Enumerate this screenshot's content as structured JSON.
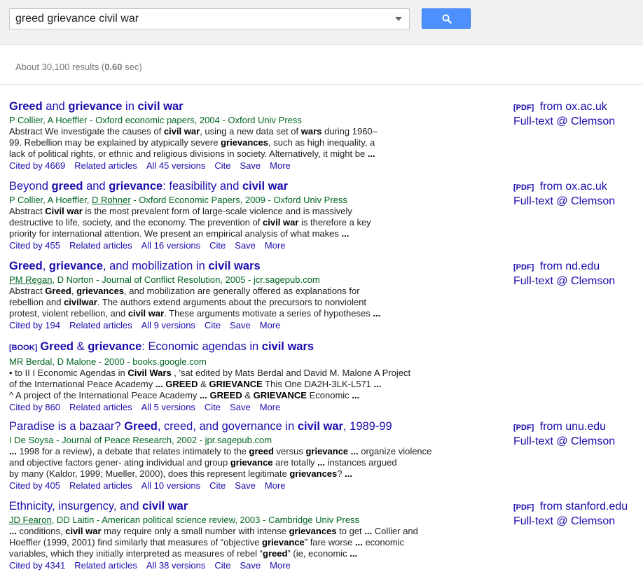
{
  "search": {
    "query": "greed grievance civil war"
  },
  "stats": {
    "prefix": "About 30,100 results (",
    "time": "0.60",
    "suffix": " sec)"
  },
  "results": [
    {
      "book_tag": "",
      "title": [
        [
          "Greed",
          true
        ],
        [
          " and ",
          false
        ],
        [
          "grievance",
          true
        ],
        [
          " in ",
          false
        ],
        [
          "civil war",
          true
        ]
      ],
      "authors": [
        [
          "P Collier, A Hoeffler - Oxford economic papers, 2004 - Oxford Univ Press",
          false
        ]
      ],
      "snippet": [
        [
          [
            "Abstract We investigate the causes of ",
            false
          ],
          [
            "civil war",
            true
          ],
          [
            ", using a new data set of ",
            false
          ],
          [
            "wars",
            true
          ],
          [
            " during 1960–",
            false
          ]
        ],
        [
          [
            "99. Rebellion may be explained by atypically severe ",
            false
          ],
          [
            "grievances",
            true
          ],
          [
            ", such as high inequality, a",
            false
          ]
        ],
        [
          [
            "lack of political rights, or ethnic and religious divisions in society. Alternatively, it might be ",
            false
          ],
          [
            "...",
            true
          ]
        ]
      ],
      "links": [
        "Cited by 4669",
        "Related articles",
        "All 45 versions",
        "Cite",
        "Save",
        "More"
      ],
      "pdf_tag": "[PDF]",
      "pdf_source": " from ox.ac.uk",
      "fulltext": "Full-text @ Clemson"
    },
    {
      "book_tag": "",
      "title": [
        [
          "Beyond ",
          false
        ],
        [
          "greed",
          true
        ],
        [
          " and ",
          false
        ],
        [
          "grievance",
          true
        ],
        [
          ": feasibility and ",
          false
        ],
        [
          "civil war",
          true
        ]
      ],
      "authors": [
        [
          "P Collier, A Hoeffler, ",
          false
        ],
        [
          "D Rohner",
          true
        ],
        [
          " - Oxford Economic Papers, 2009 - Oxford Univ Press",
          false
        ]
      ],
      "snippet": [
        [
          [
            "Abstract ",
            false
          ],
          [
            "Civil war",
            true
          ],
          [
            " is the most prevalent form of large-scale violence and is massively",
            false
          ]
        ],
        [
          [
            "destructive to life, society, and the economy. The prevention of ",
            false
          ],
          [
            "civil war",
            true
          ],
          [
            " is therefore a key",
            false
          ]
        ],
        [
          [
            "priority for international attention. We present an empirical analysis of what makes ",
            false
          ],
          [
            "...",
            true
          ]
        ]
      ],
      "links": [
        "Cited by 455",
        "Related articles",
        "All 16 versions",
        "Cite",
        "Save",
        "More"
      ],
      "pdf_tag": "[PDF]",
      "pdf_source": " from ox.ac.uk",
      "fulltext": "Full-text @ Clemson"
    },
    {
      "book_tag": "",
      "title": [
        [
          "Greed",
          true
        ],
        [
          ", ",
          false
        ],
        [
          "grievance",
          true
        ],
        [
          ", and mobilization in ",
          false
        ],
        [
          "civil wars",
          true
        ]
      ],
      "authors": [
        [
          "PM Regan",
          true
        ],
        [
          ", D Norton - Journal of Conflict Resolution, 2005 - jcr.sagepub.com",
          false
        ]
      ],
      "snippet": [
        [
          [
            "Abstract ",
            false
          ],
          [
            "Greed",
            true
          ],
          [
            ", ",
            false
          ],
          [
            "grievances",
            true
          ],
          [
            ", and mobilization are generally offered as explanations for",
            false
          ]
        ],
        [
          [
            "rebellion and ",
            false
          ],
          [
            "civilwar",
            true
          ],
          [
            ". The authors extend arguments about the precursors to nonviolent",
            false
          ]
        ],
        [
          [
            "protest, violent rebellion, and ",
            false
          ],
          [
            "civil war",
            true
          ],
          [
            ". These arguments motivate a series of hypotheses ",
            false
          ],
          [
            "...",
            true
          ]
        ]
      ],
      "links": [
        "Cited by 194",
        "Related articles",
        "All 9 versions",
        "Cite",
        "Save",
        "More"
      ],
      "pdf_tag": "[PDF]",
      "pdf_source": " from nd.edu",
      "fulltext": "Full-text @ Clemson"
    },
    {
      "book_tag": "[BOOK]",
      "title": [
        [
          "Greed",
          true
        ],
        [
          " & ",
          false
        ],
        [
          "grievance",
          true
        ],
        [
          ": Economic agendas in ",
          false
        ],
        [
          "civil wars",
          true
        ]
      ],
      "authors": [
        [
          "MR Berdal, D Malone - 2000 - books.google.com",
          false
        ]
      ],
      "snippet": [
        [
          [
            "• to II I Economic Agendas in ",
            false
          ],
          [
            "Civil Wars",
            true
          ],
          [
            " , 'sat edited by Mats Berdal and David M. Malone A Project",
            false
          ]
        ],
        [
          [
            "of the International Peace Academy ",
            false
          ],
          [
            "... GREED",
            true
          ],
          [
            " & ",
            false
          ],
          [
            "GRIEVANCE",
            true
          ],
          [
            " This One DA2H-3LK-L571 ",
            false
          ],
          [
            "...",
            true
          ]
        ],
        [
          [
            "^ A project of the International Peace Academy ",
            false
          ],
          [
            "... GREED",
            true
          ],
          [
            " & ",
            false
          ],
          [
            "GRIEVANCE",
            true
          ],
          [
            " Economic ",
            false
          ],
          [
            "...",
            true
          ]
        ]
      ],
      "links": [
        "Cited by 860",
        "Related articles",
        "All 5 versions",
        "Cite",
        "Save",
        "More"
      ],
      "pdf_tag": "",
      "pdf_source": "",
      "fulltext": ""
    },
    {
      "book_tag": "",
      "title": [
        [
          "Paradise is a bazaar? ",
          false
        ],
        [
          "Greed",
          true
        ],
        [
          ", creed, and governance in ",
          false
        ],
        [
          "civil war",
          true
        ],
        [
          ", 1989-99",
          false
        ]
      ],
      "authors": [
        [
          "I De Soysa - Journal of Peace Research, 2002 - jpr.sagepub.com",
          false
        ]
      ],
      "snippet": [
        [
          [
            "...",
            true
          ],
          [
            " 1998 for a review), a debate that relates intimately to the ",
            false
          ],
          [
            "greed",
            true
          ],
          [
            " versus ",
            false
          ],
          [
            "grievance ...",
            true
          ],
          [
            " organize violence",
            false
          ]
        ],
        [
          [
            "and objective factors gener- ating individual and group ",
            false
          ],
          [
            "grievance",
            true
          ],
          [
            " are totally ",
            false
          ],
          [
            "...",
            true
          ],
          [
            " instances argued",
            false
          ]
        ],
        [
          [
            "by many (Kaldor, 1999; Mueller, 2000), does this represent legitimate ",
            false
          ],
          [
            "grievances",
            true
          ],
          [
            "? ",
            false
          ],
          [
            "...",
            true
          ]
        ]
      ],
      "links": [
        "Cited by 405",
        "Related articles",
        "All 10 versions",
        "Cite",
        "Save",
        "More"
      ],
      "pdf_tag": "[PDF]",
      "pdf_source": " from unu.edu",
      "fulltext": "Full-text @ Clemson"
    },
    {
      "book_tag": "",
      "title": [
        [
          "Ethnicity, insurgency, and ",
          false
        ],
        [
          "civil war",
          true
        ]
      ],
      "authors": [
        [
          "JD Fearon",
          true
        ],
        [
          ", DD Laitin - American political science review, 2003 - Cambridge Univ Press",
          false
        ]
      ],
      "snippet": [
        [
          [
            "...",
            true
          ],
          [
            " conditions, ",
            false
          ],
          [
            "civil war",
            true
          ],
          [
            " may require only a small number with intense ",
            false
          ],
          [
            "grievances",
            true
          ],
          [
            " to get ",
            false
          ],
          [
            "...",
            true
          ],
          [
            " Collier and",
            false
          ]
        ],
        [
          [
            "Hoeffler (1999, 2001) find similarly that measures of “objective ",
            false
          ],
          [
            "grievance",
            true
          ],
          [
            "” fare worse ",
            false
          ],
          [
            "...",
            true
          ],
          [
            " economic",
            false
          ]
        ],
        [
          [
            "variables, which they initially interpreted as measures of rebel “",
            false
          ],
          [
            "greed",
            true
          ],
          [
            "” (ie, economic ",
            false
          ],
          [
            "...",
            true
          ]
        ]
      ],
      "links": [
        "Cited by 4341",
        "Related articles",
        "All 38 versions",
        "Cite",
        "Save",
        "More"
      ],
      "pdf_tag": "[PDF]",
      "pdf_source": " from stanford.edu",
      "fulltext": "Full-text @ Clemson"
    }
  ]
}
